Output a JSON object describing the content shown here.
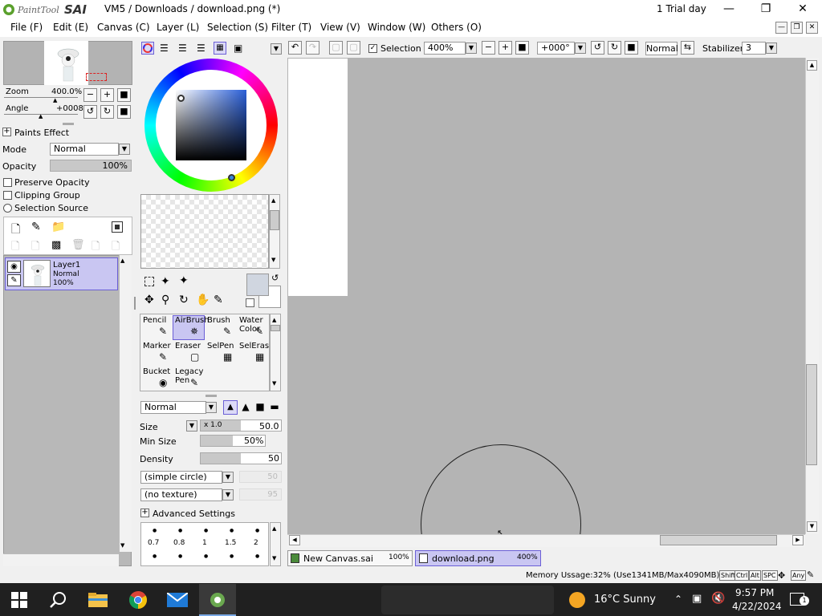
{
  "app": {
    "logo_text": "PaintTool SAI",
    "title": "VM5 / Downloads / download.png (*)",
    "trial": "1 Trial day"
  },
  "menu": [
    "File (F)",
    "Edit (E)",
    "Canvas (C)",
    "Layer (L)",
    "Selection (S)",
    "Filter (T)",
    "View (V)",
    "Window (W)",
    "Others (O)"
  ],
  "navigator": {
    "zoom_label": "Zoom",
    "zoom_value": "400.0%",
    "angle_label": "Angle",
    "angle_value": "+0008"
  },
  "paints_effect": {
    "title": "Paints Effect",
    "mode_label": "Mode",
    "mode_value": "Normal",
    "opacity_label": "Opacity",
    "opacity_value": "100%",
    "preserve_opacity": "Preserve Opacity",
    "clipping_group": "Clipping Group",
    "selection_source": "Selection Source"
  },
  "layer": {
    "name": "Layer1",
    "mode": "Normal",
    "opacity": "100%"
  },
  "tools": [
    {
      "label": "Pencil"
    },
    {
      "label": "AirBrush"
    },
    {
      "label": "Brush"
    },
    {
      "label": "Water Color"
    },
    {
      "label": "Marker"
    },
    {
      "label": "Eraser"
    },
    {
      "label": "SelPen"
    },
    {
      "label": "SelEras"
    },
    {
      "label": "Bucket"
    },
    {
      "label": "Legacy Pen"
    }
  ],
  "brush": {
    "blend_mode": "Normal",
    "size_label": "Size",
    "size_mult": "x 1.0",
    "size_value": "50.0",
    "minsize_label": "Min Size",
    "minsize_value": "50%",
    "density_label": "Density",
    "density_value": "50",
    "shape": "(simple circle)",
    "shape_value": "50",
    "texture": "(no texture)",
    "texture_value": "95",
    "advanced": "Advanced Settings",
    "dot_sizes": [
      "0.7",
      "0.8",
      "1",
      "1.5",
      "2"
    ]
  },
  "toolbar": {
    "selection_label": "Selection",
    "zoom": "400%",
    "angle": "+000°",
    "blend": "Normal",
    "stabilizer_label": "Stabilizer",
    "stabilizer_value": "3"
  },
  "tabs": [
    {
      "name": "New Canvas.sai",
      "zoom": "100%"
    },
    {
      "name": "download.png",
      "zoom": "400%"
    }
  ],
  "status": {
    "memory": "Memory Ussage:32% (Use1341MB/Max4090MB)",
    "keys": [
      "Shift",
      "Ctrl",
      "Alt",
      "SPC",
      "Any"
    ]
  },
  "taskbar": {
    "weather": "16°C  Sunny",
    "time": "9:57 PM",
    "date": "4/22/2024",
    "notif_count": "1"
  },
  "colors": {
    "accent_layer": "#c9c6f2",
    "canvas_bg": "#b4b4b4",
    "taskbar": "#202020"
  }
}
